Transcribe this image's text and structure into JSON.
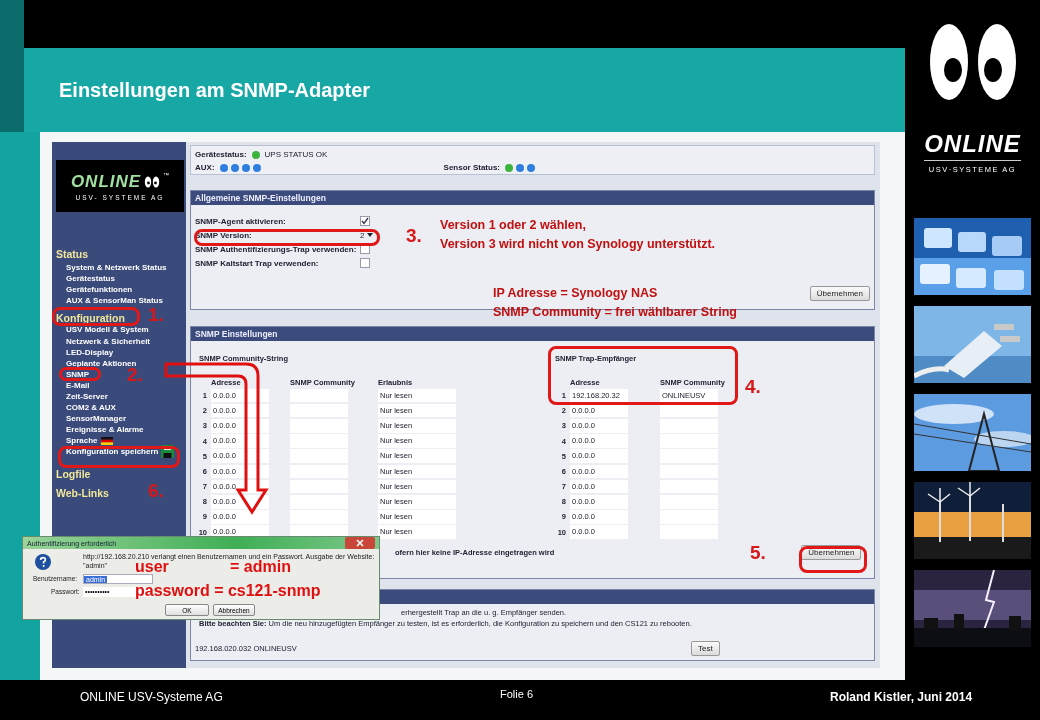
{
  "slide": {
    "title": "Einstellungen am SNMP-Adapter",
    "footer_left": "ONLINE USV-Systeme AG",
    "footer_center": "Folie 6",
    "footer_right": "Roland Kistler, Juni 2014"
  },
  "brand": {
    "name": "ONLINE",
    "tagline": "USV·SYSTEME AG"
  },
  "web": {
    "logo": {
      "name": "ONLINE",
      "tm": "™",
      "tagline": "USV- SYSTEME AG"
    },
    "header": {
      "device_status_label": "Gerätestatus:",
      "device_status": {
        "text": "UPS STATUS OK",
        "color": "#3cb43c"
      },
      "aux_label": "AUX:",
      "aux_leds": [
        {
          "color": "#2f7fe0"
        },
        {
          "color": "#2f7fe0"
        },
        {
          "color": "#2f7fe0"
        },
        {
          "color": "#2f7fe0"
        }
      ],
      "sensor_label": "Sensor Status:",
      "sensor_leds": [
        {
          "color": "#3cb43c"
        },
        {
          "color": "#2f7fe0"
        },
        {
          "color": "#2f7fe0"
        }
      ]
    },
    "sidebar": [
      {
        "title": "Status",
        "items": [
          {
            "label": "System & Netzwerk Status"
          },
          {
            "label": "Gerätestatus"
          },
          {
            "label": "Gerätefunktionen"
          },
          {
            "label": "AUX & SensorMan Status"
          }
        ]
      },
      {
        "title": "Konfiguration",
        "items": [
          {
            "label": "USV Modell & System"
          },
          {
            "label": "Netzwerk & Sicherheit"
          },
          {
            "label": "LED-Display"
          },
          {
            "label": "Geplante Aktionen"
          },
          {
            "label": "SNMP"
          },
          {
            "label": "E-Mail"
          },
          {
            "label": "Zeit-Server"
          },
          {
            "label": "COM2 & AUX"
          },
          {
            "label": "SensorManager"
          },
          {
            "label": "Ereignisse & Alarme"
          },
          {
            "label": "Sprache",
            "kind": "flag"
          },
          {
            "label": "Konfiguration speichern",
            "kind": "save"
          }
        ]
      },
      {
        "title": "Logfile"
      },
      {
        "title": "Web-Links"
      }
    ],
    "general": {
      "title": "Allgemeine SNMP-Einstellungen",
      "rows": [
        {
          "label": "SNMP-Agent aktivieren:",
          "kind": "checkbox",
          "checked": true
        },
        {
          "label": "SNMP Version:",
          "kind": "select",
          "value": "2"
        },
        {
          "label": "SNMP Authentifizierungs-Trap verwenden:",
          "kind": "checkbox",
          "checked": false
        },
        {
          "label": "SNMP Kaltstart Trap verwenden:",
          "kind": "checkbox",
          "checked": false
        }
      ],
      "button": "Übernehmen"
    },
    "snmp": {
      "title": "SNMP Einstellungen",
      "community": {
        "title": "SNMP Community-String",
        "columns": [
          "Adresse",
          "SNMP Community",
          "Erlaubnis"
        ],
        "rows": [
          {
            "num": "1",
            "address": "0.0.0.0",
            "permission": "Nur lesen"
          },
          {
            "num": "2",
            "address": "0.0.0.0",
            "permission": "Nur lesen"
          },
          {
            "num": "3",
            "address": "0.0.0.0",
            "permission": "Nur lesen"
          },
          {
            "num": "4",
            "address": "0.0.0.0",
            "permission": "Nur lesen"
          },
          {
            "num": "5",
            "address": "0.0.0.0",
            "permission": "Nur lesen"
          },
          {
            "num": "6",
            "address": "0.0.0.0",
            "permission": "Nur lesen"
          },
          {
            "num": "7",
            "address": "0.0.0.0",
            "permission": "Nur lesen"
          },
          {
            "num": "8",
            "address": "0.0.0.0",
            "permission": "Nur lesen"
          },
          {
            "num": "9",
            "address": "0.0.0.0",
            "permission": "Nur lesen"
          },
          {
            "num": "10",
            "address": "0.0.0.0",
            "permission": "Nur lesen"
          }
        ]
      },
      "trap": {
        "title": "SNMP Trap-Empfänger",
        "columns": [
          "Adresse",
          "SNMP Community"
        ],
        "rows": [
          {
            "num": "1",
            "address": "192.168.20.32",
            "community": "ONLINEUSV"
          },
          {
            "num": "2",
            "address": "0.0.0.0"
          },
          {
            "num": "3",
            "address": "0.0.0.0"
          },
          {
            "num": "4",
            "address": "0.0.0.0"
          },
          {
            "num": "5",
            "address": "0.0.0.0"
          },
          {
            "num": "6",
            "address": "0.0.0.0"
          },
          {
            "num": "7",
            "address": "0.0.0.0"
          },
          {
            "num": "8",
            "address": "0.0.0.0"
          },
          {
            "num": "9",
            "address": "0.0.0.0"
          },
          {
            "num": "10",
            "address": "0.0.0.0"
          }
        ]
      },
      "note": "ofern hier keine IP-Adresse eingetragen wird",
      "button": "Übernehmen"
    },
    "test": {
      "lines": [
        "erhergestellt Trap an die u. g. Empfänger senden.",
        "**Bitte beachten Sie:** Um die neu hinzugefügten Empfänger zu testen, ist es erforderlich, die Konfiguration zu speichern und den CS121 zu rebooten."
      ],
      "receiver": "192.168.020.032  ONLINEUSV",
      "button": "Test"
    }
  },
  "dialog": {
    "title": "Authentifizierung erforderlich",
    "message_lines": [
      "http://192.168.20.210 verlangt einen Benutzernamen und ein Passwort. Ausgabe der Website:",
      "\"admin\""
    ],
    "username_label": "Benutzername:",
    "username": "admin",
    "password_label": "Passwort:",
    "password": "••••••••••",
    "ok": "OK",
    "cancel": "Abbrechen"
  },
  "annotations": {
    "steps": [
      "1.",
      "2.",
      "3.",
      "4.",
      "5.",
      "6."
    ],
    "version_note": [
      "Version 1 oder 2 wählen,",
      "Version 3 wird nicht von Synology unterstützt."
    ],
    "ip_note": [
      "IP Adresse = Synology NAS",
      "SNMP Community = frei wählbarer String"
    ],
    "user_label": "user",
    "user_value": "= admin",
    "password_line": "password = cs121-snmp"
  }
}
